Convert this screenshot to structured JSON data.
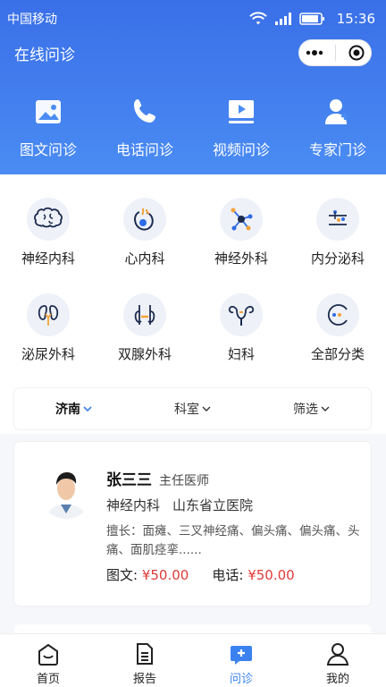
{
  "status_bar": {
    "carrier": "中国移动",
    "time": "15:36"
  },
  "nav": {
    "title": "在线问诊"
  },
  "consult_types": [
    {
      "label": "图文问诊",
      "icon": "image-icon"
    },
    {
      "label": "电话问诊",
      "icon": "phone-icon"
    },
    {
      "label": "视频问诊",
      "icon": "video-icon"
    },
    {
      "label": "专家门诊",
      "icon": "doctor-icon"
    }
  ],
  "departments": [
    {
      "label": "神经内科",
      "icon": "brain-icon"
    },
    {
      "label": "心内科",
      "icon": "heart-icon"
    },
    {
      "label": "神经外科",
      "icon": "neuron-icon"
    },
    {
      "label": "内分泌科",
      "icon": "endocrine-icon"
    },
    {
      "label": "泌尿外科",
      "icon": "kidney-icon"
    },
    {
      "label": "双腺外科",
      "icon": "thyroid-icon"
    },
    {
      "label": "妇科",
      "icon": "uterus-icon"
    },
    {
      "label": "全部分类",
      "icon": "more-icon"
    }
  ],
  "filters": {
    "city": "济南",
    "department": "科室",
    "filter": "筛选"
  },
  "doctor": {
    "name": "张三三",
    "title": "主任医师",
    "department": "神经内科",
    "hospital": "山东省立医院",
    "specialty": "擅长：面瘫、三叉神经痛、偏头痛、偏头痛、头痛、面肌痉挛......",
    "text_price_label": "图文:",
    "text_price": "¥50.00",
    "phone_price_label": "电话:",
    "phone_price": "¥50.00"
  },
  "tabbar": [
    {
      "label": "首页",
      "icon": "home-icon"
    },
    {
      "label": "报告",
      "icon": "report-icon"
    },
    {
      "label": "问诊",
      "icon": "consult-icon"
    },
    {
      "label": "我的",
      "icon": "profile-icon"
    }
  ],
  "colors": {
    "primary": "#3b82f0",
    "price": "#e03a3a",
    "header_top": "#3a6fe8",
    "header_bottom": "#4a8cf3"
  }
}
